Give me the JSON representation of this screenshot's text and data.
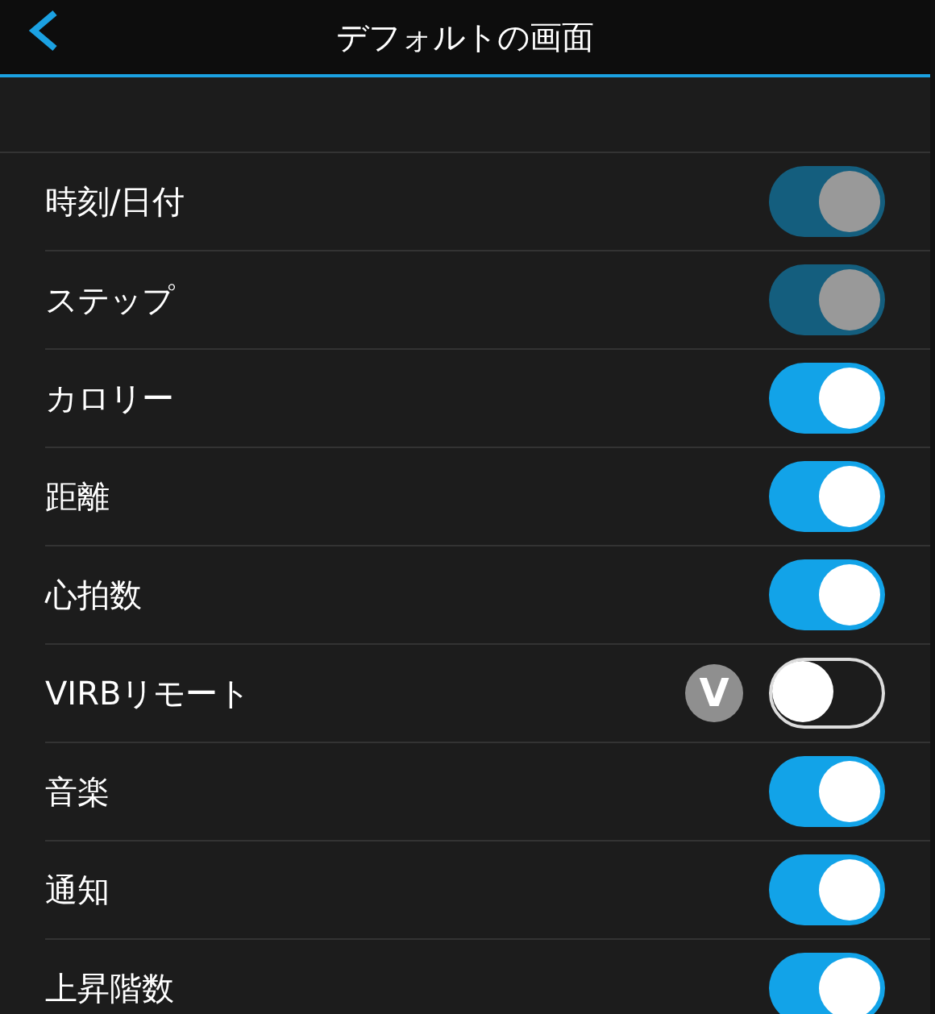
{
  "header": {
    "title": "デフォルトの画面"
  },
  "rows": [
    {
      "label": "時刻/日付",
      "on": true,
      "disabled": true
    },
    {
      "label": "ステップ",
      "on": true,
      "disabled": true
    },
    {
      "label": "カロリー",
      "on": true,
      "disabled": false
    },
    {
      "label": "距離",
      "on": true,
      "disabled": false
    },
    {
      "label": "心拍数",
      "on": true,
      "disabled": false
    },
    {
      "label": "VIRBリモート",
      "on": false,
      "disabled": false,
      "badge": "V"
    },
    {
      "label": "音楽",
      "on": true,
      "disabled": false
    },
    {
      "label": "通知",
      "on": true,
      "disabled": false
    },
    {
      "label": "上昇階数",
      "on": true,
      "disabled": false
    }
  ]
}
